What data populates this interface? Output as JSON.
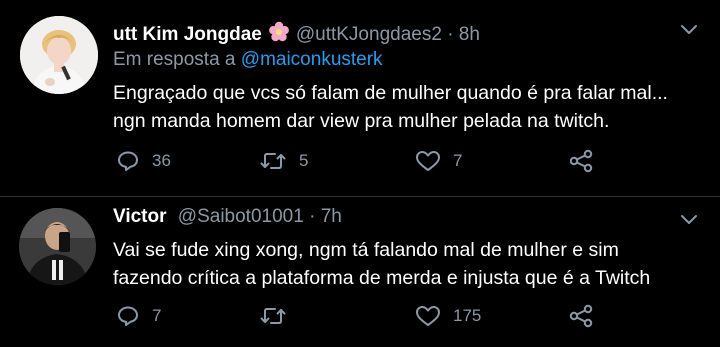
{
  "colors": {
    "background": "#000000",
    "text": "#ffffff",
    "secondary": "#8b98a5",
    "link": "#1da1f2",
    "divider": "#2f3336"
  },
  "tweets": [
    {
      "display_name": "utt Kim Jongdae",
      "name_emoji": "flower-icon",
      "handle": "@uttKJongdaes2",
      "separator": "·",
      "time": "8h",
      "reply_prefix": "Em resposta a",
      "reply_mention": "@maiconkusterk",
      "lines": [
        "Engraçado que vcs só falam de mulher quando é pra falar mal...",
        "ngn manda homem dar view pra mulher pelada na twitch."
      ],
      "replies": "36",
      "retweets": "5",
      "likes": "7"
    },
    {
      "display_name": "Victor",
      "handle": "@Saibot01001",
      "separator": "·",
      "time": "7h",
      "lines": [
        "Vai se fude xing xong, ngm tá falando mal de mulher e sim",
        "fazendo crítica a plataforma de merda e injusta que é a Twitch"
      ],
      "replies": "7",
      "retweets": "",
      "likes": "175"
    }
  ]
}
